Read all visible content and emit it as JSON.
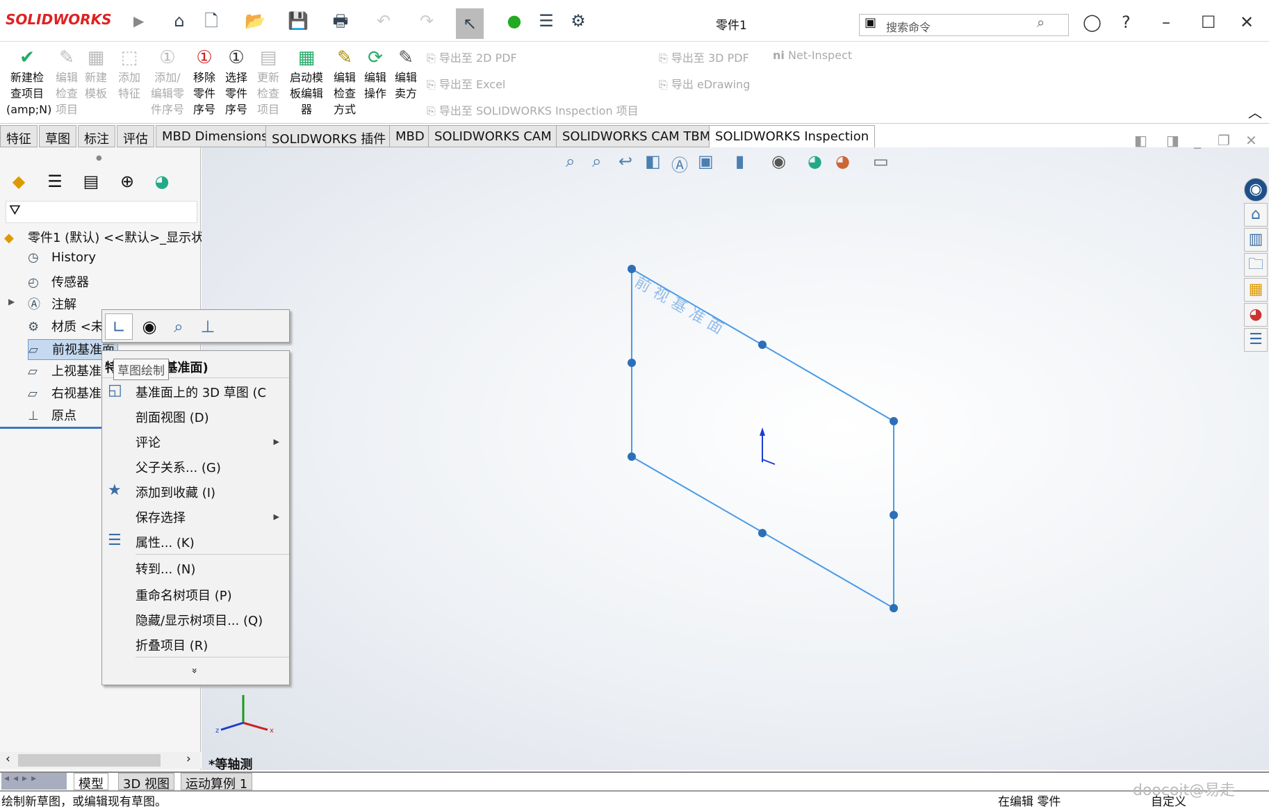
{
  "app": {
    "logo": "SOLIDWORKS",
    "title": "零件1",
    "search_placeholder": "搜索命令"
  },
  "ribbon": {
    "buttons": [
      {
        "label": "新建检查项目(amp;N)",
        "enabled": true
      },
      {
        "label": "编辑检查项目",
        "enabled": false
      },
      {
        "label": "新建模板",
        "enabled": false
      },
      {
        "label": "添加特征",
        "enabled": false
      },
      {
        "label": "添加/编辑零件序号",
        "enabled": false
      },
      {
        "label": "移除零件序号",
        "enabled": true
      },
      {
        "label": "选择零件序号",
        "enabled": true
      },
      {
        "label": "更新检查项目",
        "enabled": false
      },
      {
        "label": "启动模板编辑器",
        "enabled": true
      },
      {
        "label": "编辑检查方式",
        "enabled": true
      },
      {
        "label": "编辑操作",
        "enabled": true
      },
      {
        "label": "编辑卖方",
        "enabled": true
      }
    ],
    "exports": [
      "导出至 2D PDF",
      "导出至 Excel",
      "导出至 SOLIDWORKS Inspection 项目",
      "导出至 3D PDF",
      "导出 eDrawing",
      "Net-Inspect"
    ]
  },
  "tabs": [
    "特征",
    "草图",
    "标注",
    "评估",
    "MBD Dimensions",
    "SOLIDWORKS 插件",
    "MBD",
    "SOLIDWORKS CAM",
    "SOLIDWORKS CAM TBM",
    "SOLIDWORKS Inspection"
  ],
  "active_tab": "SOLIDWORKS Inspection",
  "tree": {
    "root": "零件1 (默认) <<默认>_显示状态",
    "items": [
      "History",
      "传感器",
      "注解",
      "材质 <未",
      "前视基准面",
      "上视基准",
      "右视基准",
      "原点"
    ],
    "selected": "前视基准面"
  },
  "context_menu": {
    "header": "特征 (前视基准面)",
    "tooltip": "草图绘制",
    "items": [
      {
        "label": "基准面上的 3D 草图 (C",
        "icon": "3d-sketch-icon"
      },
      {
        "label": "剖面视图 (D)"
      },
      {
        "label": "评论",
        "submenu": true
      },
      {
        "label": "父子关系... (G)"
      },
      {
        "label": "添加到收藏 (I)",
        "icon": "favorite-icon"
      },
      {
        "label": "保存选择",
        "submenu": true
      },
      {
        "label": "属性... (K)",
        "icon": "properties-icon"
      },
      {
        "label": "转到... (N)"
      },
      {
        "label": "重命名树项目 (P)"
      },
      {
        "label": "隐藏/显示树项目... (Q)"
      },
      {
        "label": "折叠项目 (R)"
      }
    ],
    "expand": "»"
  },
  "viewport": {
    "plane_label": "前视基准面",
    "view_name": "*等轴测",
    "plane_color": "#4a9be6"
  },
  "bottom_tabs": [
    "模型",
    "3D 视图",
    "运动算例 1"
  ],
  "status": {
    "message": "绘制新草图，或编辑现有草图。",
    "mode": "在编辑 零件",
    "units": "自定义",
    "watermark": "doocoit@易走"
  }
}
